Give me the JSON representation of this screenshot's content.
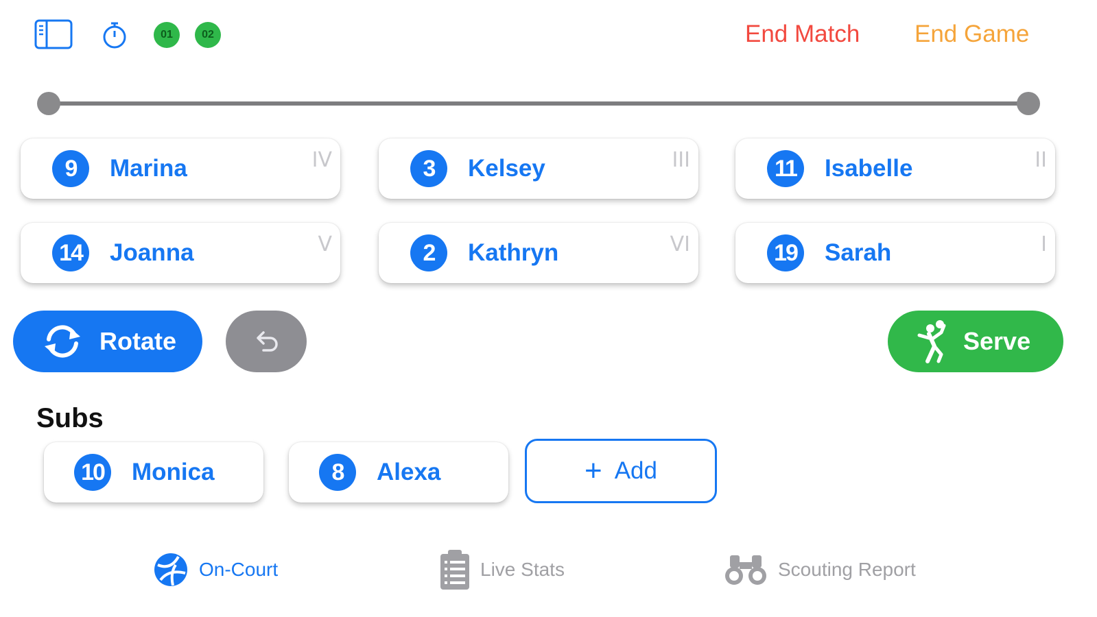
{
  "header": {
    "timeouts": [
      "01",
      "02"
    ],
    "end_match_label": "End Match",
    "end_game_label": "End Game",
    "colors": {
      "end_match": "#f2493f",
      "end_game": "#f5a43a",
      "accent": "#1677f2",
      "timeout": "#2fb84a"
    }
  },
  "court": {
    "players": [
      {
        "number": "9",
        "name": "Marina",
        "rotation": "IV"
      },
      {
        "number": "3",
        "name": "Kelsey",
        "rotation": "III"
      },
      {
        "number": "11",
        "name": "Isabelle",
        "rotation": "II"
      },
      {
        "number": "14",
        "name": "Joanna",
        "rotation": "V"
      },
      {
        "number": "2",
        "name": "Kathryn",
        "rotation": "VI"
      },
      {
        "number": "19",
        "name": "Sarah",
        "rotation": "I"
      }
    ]
  },
  "actions": {
    "rotate_label": "Rotate",
    "serve_label": "Serve",
    "undo_icon": "undo-arrow-icon"
  },
  "subs": {
    "title": "Subs",
    "players": [
      {
        "number": "10",
        "name": "Monica"
      },
      {
        "number": "8",
        "name": "Alexa"
      }
    ],
    "add_label": "Add"
  },
  "tabs": [
    {
      "label": "On-Court",
      "icon": "volleyball-icon",
      "active": true
    },
    {
      "label": "Live Stats",
      "icon": "clipboard-icon",
      "active": false
    },
    {
      "label": "Scouting Report",
      "icon": "binoculars-icon",
      "active": false
    }
  ]
}
